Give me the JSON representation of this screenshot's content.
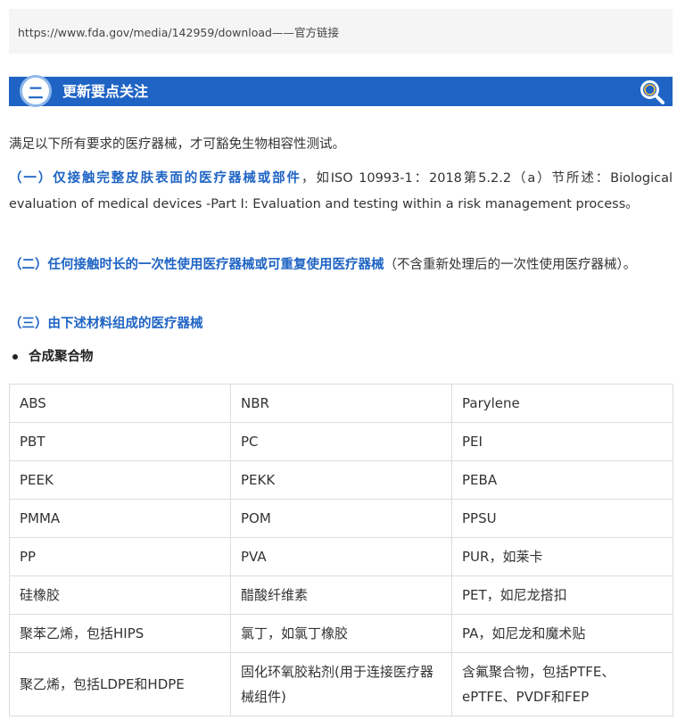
{
  "url_box": {
    "text": "https://www.fda.gov/media/142959/download——官方链接"
  },
  "banner": {
    "number": "二",
    "title": "更新要点关注",
    "icon": "search-icon",
    "color": "#1f64c4"
  },
  "intro": "满足以下所有要求的医疗器械，才可豁免生物相容性测试。",
  "items": [
    {
      "heading": "（一）仅接触完整皮肤表面的医疗器械或部件",
      "text": "，如ISO 10993-1：2018第5.2.2（a）节所述：Biological evaluation of medical devices -Part I: Evaluation and testing within a risk management process。"
    },
    {
      "heading": "（二）任何接触时长的一次性使用医疗器械或可重复使用医疗器械",
      "text": "（不含重新处理后的一次性使用医疗器械）。"
    },
    {
      "heading": "（三）由下述材料组成的医疗器械",
      "text": ""
    }
  ],
  "bullet": "合成聚合物",
  "materials_table": [
    [
      "ABS",
      " NBR",
      "Parylene"
    ],
    [
      "PBT",
      "PC",
      "PEI"
    ],
    [
      "PEEK",
      "PEKK",
      "PEBA"
    ],
    [
      "PMMA",
      "POM",
      "PPSU"
    ],
    [
      "PP",
      "PVA",
      "PUR，如莱卡"
    ],
    [
      "硅橡胶",
      "醋酸纤维素",
      "PET，如尼龙搭扣"
    ],
    [
      "聚苯乙烯，包括HIPS",
      "氯丁，如氯丁橡胶",
      "PA，如尼龙和魔术贴"
    ],
    [
      "聚乙烯，包括LDPE和HDPE",
      "固化环氧胶粘剂(用于连接医疗器械组件)",
      "含氟聚合物，包括PTFE、ePTFE、PVDF和FEP"
    ]
  ]
}
